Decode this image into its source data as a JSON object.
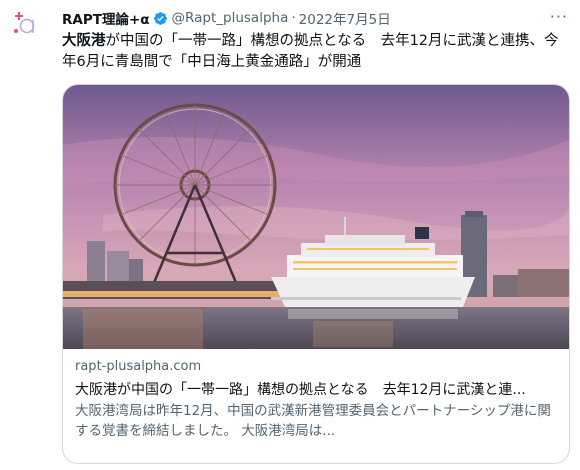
{
  "tweet": {
    "author_name": "RAPT理論+α",
    "handle": "@Rapt_plusalpha",
    "separator": "·",
    "date": "2022年7月5日",
    "more": "···",
    "text_bold": "大阪港",
    "text_rest": "が中国の「一帯一路」構想の拠点となる　去年12月に武漢と連携、今年6月に青島間で「中日海上黄金通路」が開通"
  },
  "card": {
    "domain": "rapt-plusalpha.com",
    "title": "大阪港が中国の「一帯一路」構想の拠点となる　去年12月に武漢と連...",
    "description": "大阪港湾局は昨年12月、中国の武漢新港管理委員会とパートナーシップ港に関する覚書を締結しました。 大阪港湾局は..."
  },
  "colors": {
    "verified": "#1d9bf0",
    "avatar_accent": "#e44d9c",
    "secondary_text": "#536471",
    "border": "#cfd9de"
  },
  "icons": [
    "avatar-logo",
    "verified-badge-icon",
    "more-options-icon"
  ]
}
